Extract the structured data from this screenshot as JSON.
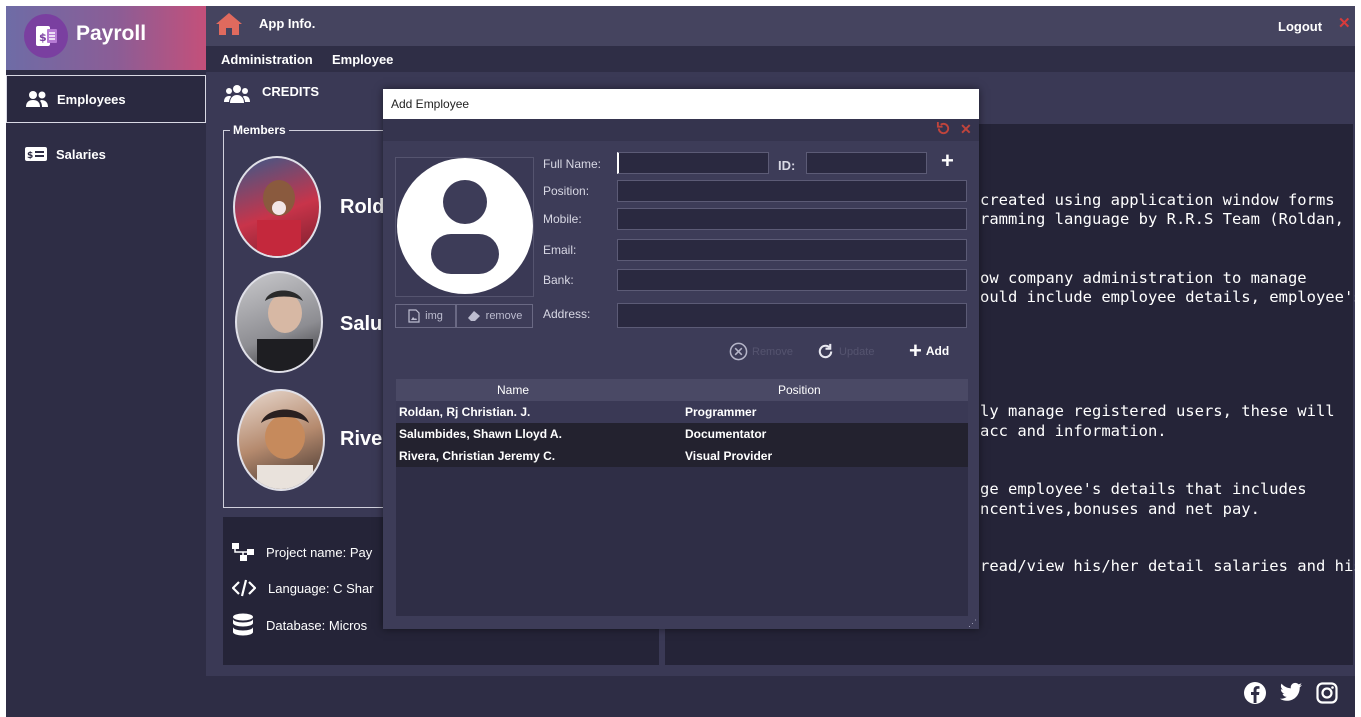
{
  "app": {
    "title": "Payroll",
    "logout_label": "Logout",
    "app_info_label": "App Info."
  },
  "menu": {
    "items": [
      "Administration",
      "Employee"
    ]
  },
  "sidebar": {
    "items": [
      {
        "label": "Employees",
        "icon": "users-icon"
      },
      {
        "label": "Salaries",
        "icon": "salary-icon"
      }
    ]
  },
  "credits": {
    "label": "CREDITS",
    "members_legend": "Members",
    "members": [
      {
        "name": "Rolda"
      },
      {
        "name": "Salur"
      },
      {
        "name": "River"
      }
    ],
    "info": [
      {
        "icon": "project-icon",
        "text": "Project name: Pay"
      },
      {
        "icon": "code-icon",
        "text": "Language: C Shar"
      },
      {
        "icon": "database-icon",
        "text": "Database:  Micros"
      }
    ],
    "description_lines": [
      "created using application window forms",
      "ramming language by R.R.S Team (Roldan,",
      "ow company administration to manage",
      "ould include employee details, employee's",
      "ly manage registered users, these will",
      "acc and information.",
      "ge employee's details that includes",
      "ncentives,bonuses and net pay.",
      "read/view his/her detail salaries and his/"
    ]
  },
  "dialog": {
    "title": "Add Employee",
    "img_label": "img",
    "remove_img_label": "remove",
    "fields": {
      "full_name": {
        "label": "Full Name:",
        "value": ""
      },
      "id": {
        "label": "ID:",
        "value": ""
      },
      "position": {
        "label": "Position:",
        "value": ""
      },
      "mobile": {
        "label": "Mobile:",
        "value": ""
      },
      "email": {
        "label": "Email:",
        "value": ""
      },
      "bank": {
        "label": "Bank:",
        "value": ""
      },
      "address": {
        "label": "Address:",
        "value": ""
      }
    },
    "actions": {
      "remove": "Remove",
      "update": "Update",
      "add": "Add"
    },
    "grid": {
      "columns": [
        "Name",
        "Position"
      ],
      "rows": [
        {
          "name": "Roldan, Rj Christian. J.",
          "position": "Programmer"
        },
        {
          "name": "Salumbides, Shawn Lloyd A.",
          "position": "Documentator"
        },
        {
          "name": "Rivera, Christian Jeremy C.",
          "position": "Visual Provider"
        }
      ]
    }
  },
  "colors": {
    "accent": "#e06a5e",
    "close": "#d83b3b",
    "background": "#2e2d45"
  }
}
